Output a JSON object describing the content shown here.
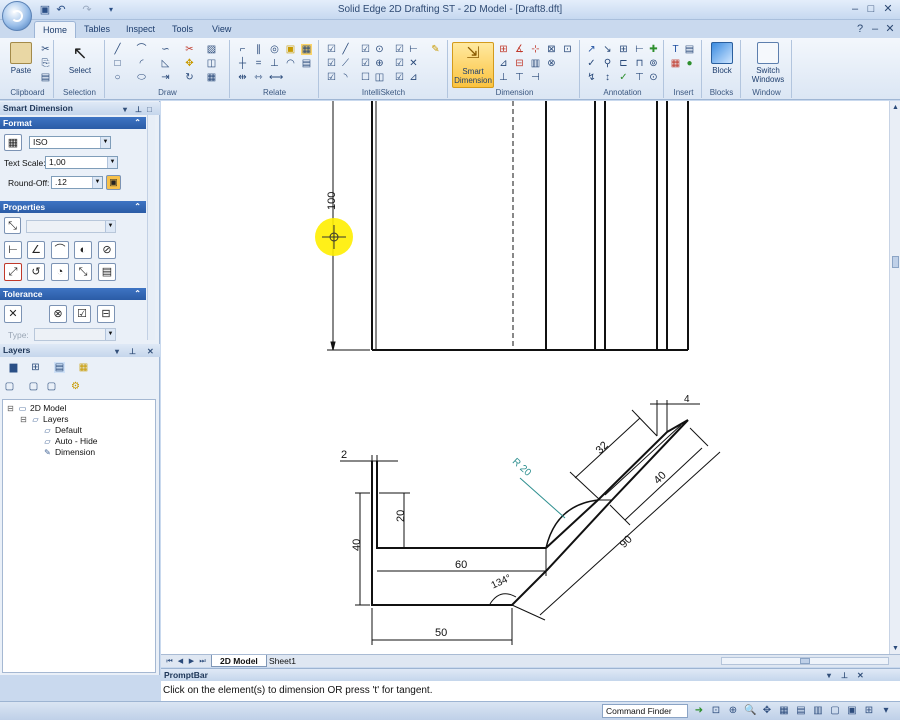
{
  "window": {
    "title": "Solid Edge 2D Drafting ST - 2D Model - [Draft8.dft]",
    "minimize": "–",
    "maximize": "□",
    "close": "✕",
    "qat_icons": [
      "save-icon",
      "undo-icon",
      "redo-icon"
    ]
  },
  "tabs": [
    "Home",
    "Tables",
    "Inspect",
    "Tools",
    "View"
  ],
  "ribbon": {
    "paste": "Paste",
    "select": "Select",
    "smart_dimension": "Smart\nDimension",
    "block": "Block",
    "switch_windows": "Switch\nWindows",
    "groups": [
      "Clipboard",
      "Selection",
      "Draw",
      "Relate",
      "IntelliSketch",
      "Dimension",
      "Annotation",
      "Insert",
      "Blocks",
      "Window"
    ]
  },
  "smart_dimension_panel": {
    "title": "Smart Dimension",
    "format": {
      "header": "Format",
      "standard": "ISO",
      "text_scale_label": "Text Scale:",
      "text_scale": "1,00",
      "round_off_label": "Round-Off:",
      "round_off": ".12"
    },
    "properties_header": "Properties",
    "tolerance": {
      "header": "Tolerance",
      "type_label": "Type:"
    }
  },
  "layers_panel": {
    "title": "Layers",
    "tree": [
      {
        "label": "2D Model",
        "level": 0
      },
      {
        "label": "Layers",
        "level": 1
      },
      {
        "label": "Default",
        "level": 2
      },
      {
        "label": "Auto - Hide",
        "level": 2
      },
      {
        "label": "Dimension",
        "level": 2
      }
    ]
  },
  "drawing": {
    "dim_vertical_top": "100",
    "dim_2": "2",
    "dim_20": "20",
    "dim_40_left": "40",
    "dim_60": "60",
    "dim_50": "50",
    "dim_angle": "134°",
    "dim_r20": "R 20",
    "dim_32": "32",
    "dim_4": "4",
    "dim_40_diag": "40",
    "dim_90": "90"
  },
  "sheets": {
    "active": "2D Model",
    "other": "Sheet1"
  },
  "promptbar": {
    "title": "PromptBar",
    "text": "Click on the element(s) to dimension OR press 't' for tangent."
  },
  "statusbar": {
    "command_finder": "Command Finder"
  },
  "colors": {
    "accent": "#2b5ca6",
    "highlight": "#fbc33f",
    "cursor_halo": "#ffee00",
    "r20_color": "#2d8f8f"
  }
}
